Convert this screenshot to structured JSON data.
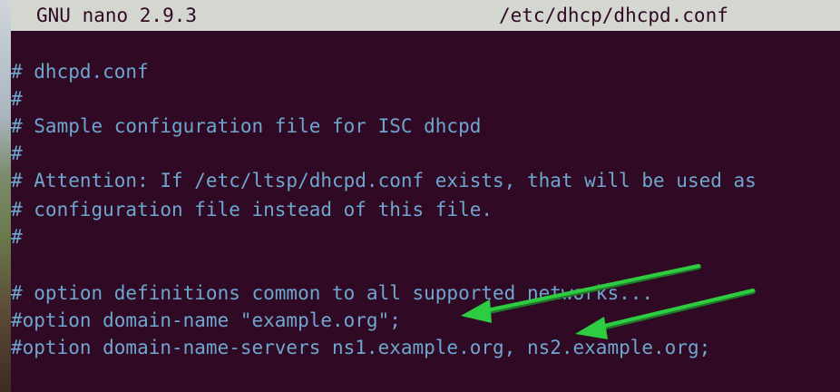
{
  "window": {
    "app_label": "GNU nano 2.9.3",
    "file_path": "/etc/dhcp/dhcpd.conf"
  },
  "editor": {
    "lines": [
      "# dhcpd.conf",
      "#",
      "# Sample configuration file for ISC dhcpd",
      "#",
      "# Attention: If /etc/ltsp/dhcpd.conf exists, that will be used as",
      "# configuration file instead of this file.",
      "#",
      "",
      "# option definitions common to all supported networks...",
      "#option domain-name \"example.org\";",
      "#option domain-name-servers ns1.example.org, ns2.example.org;"
    ]
  },
  "colors": {
    "terminal_bg": "#300a24",
    "titlebar_bg": "#d3d7cf",
    "comment_text": "#6fa6cf",
    "annotation_arrow": "#2ecc40"
  }
}
